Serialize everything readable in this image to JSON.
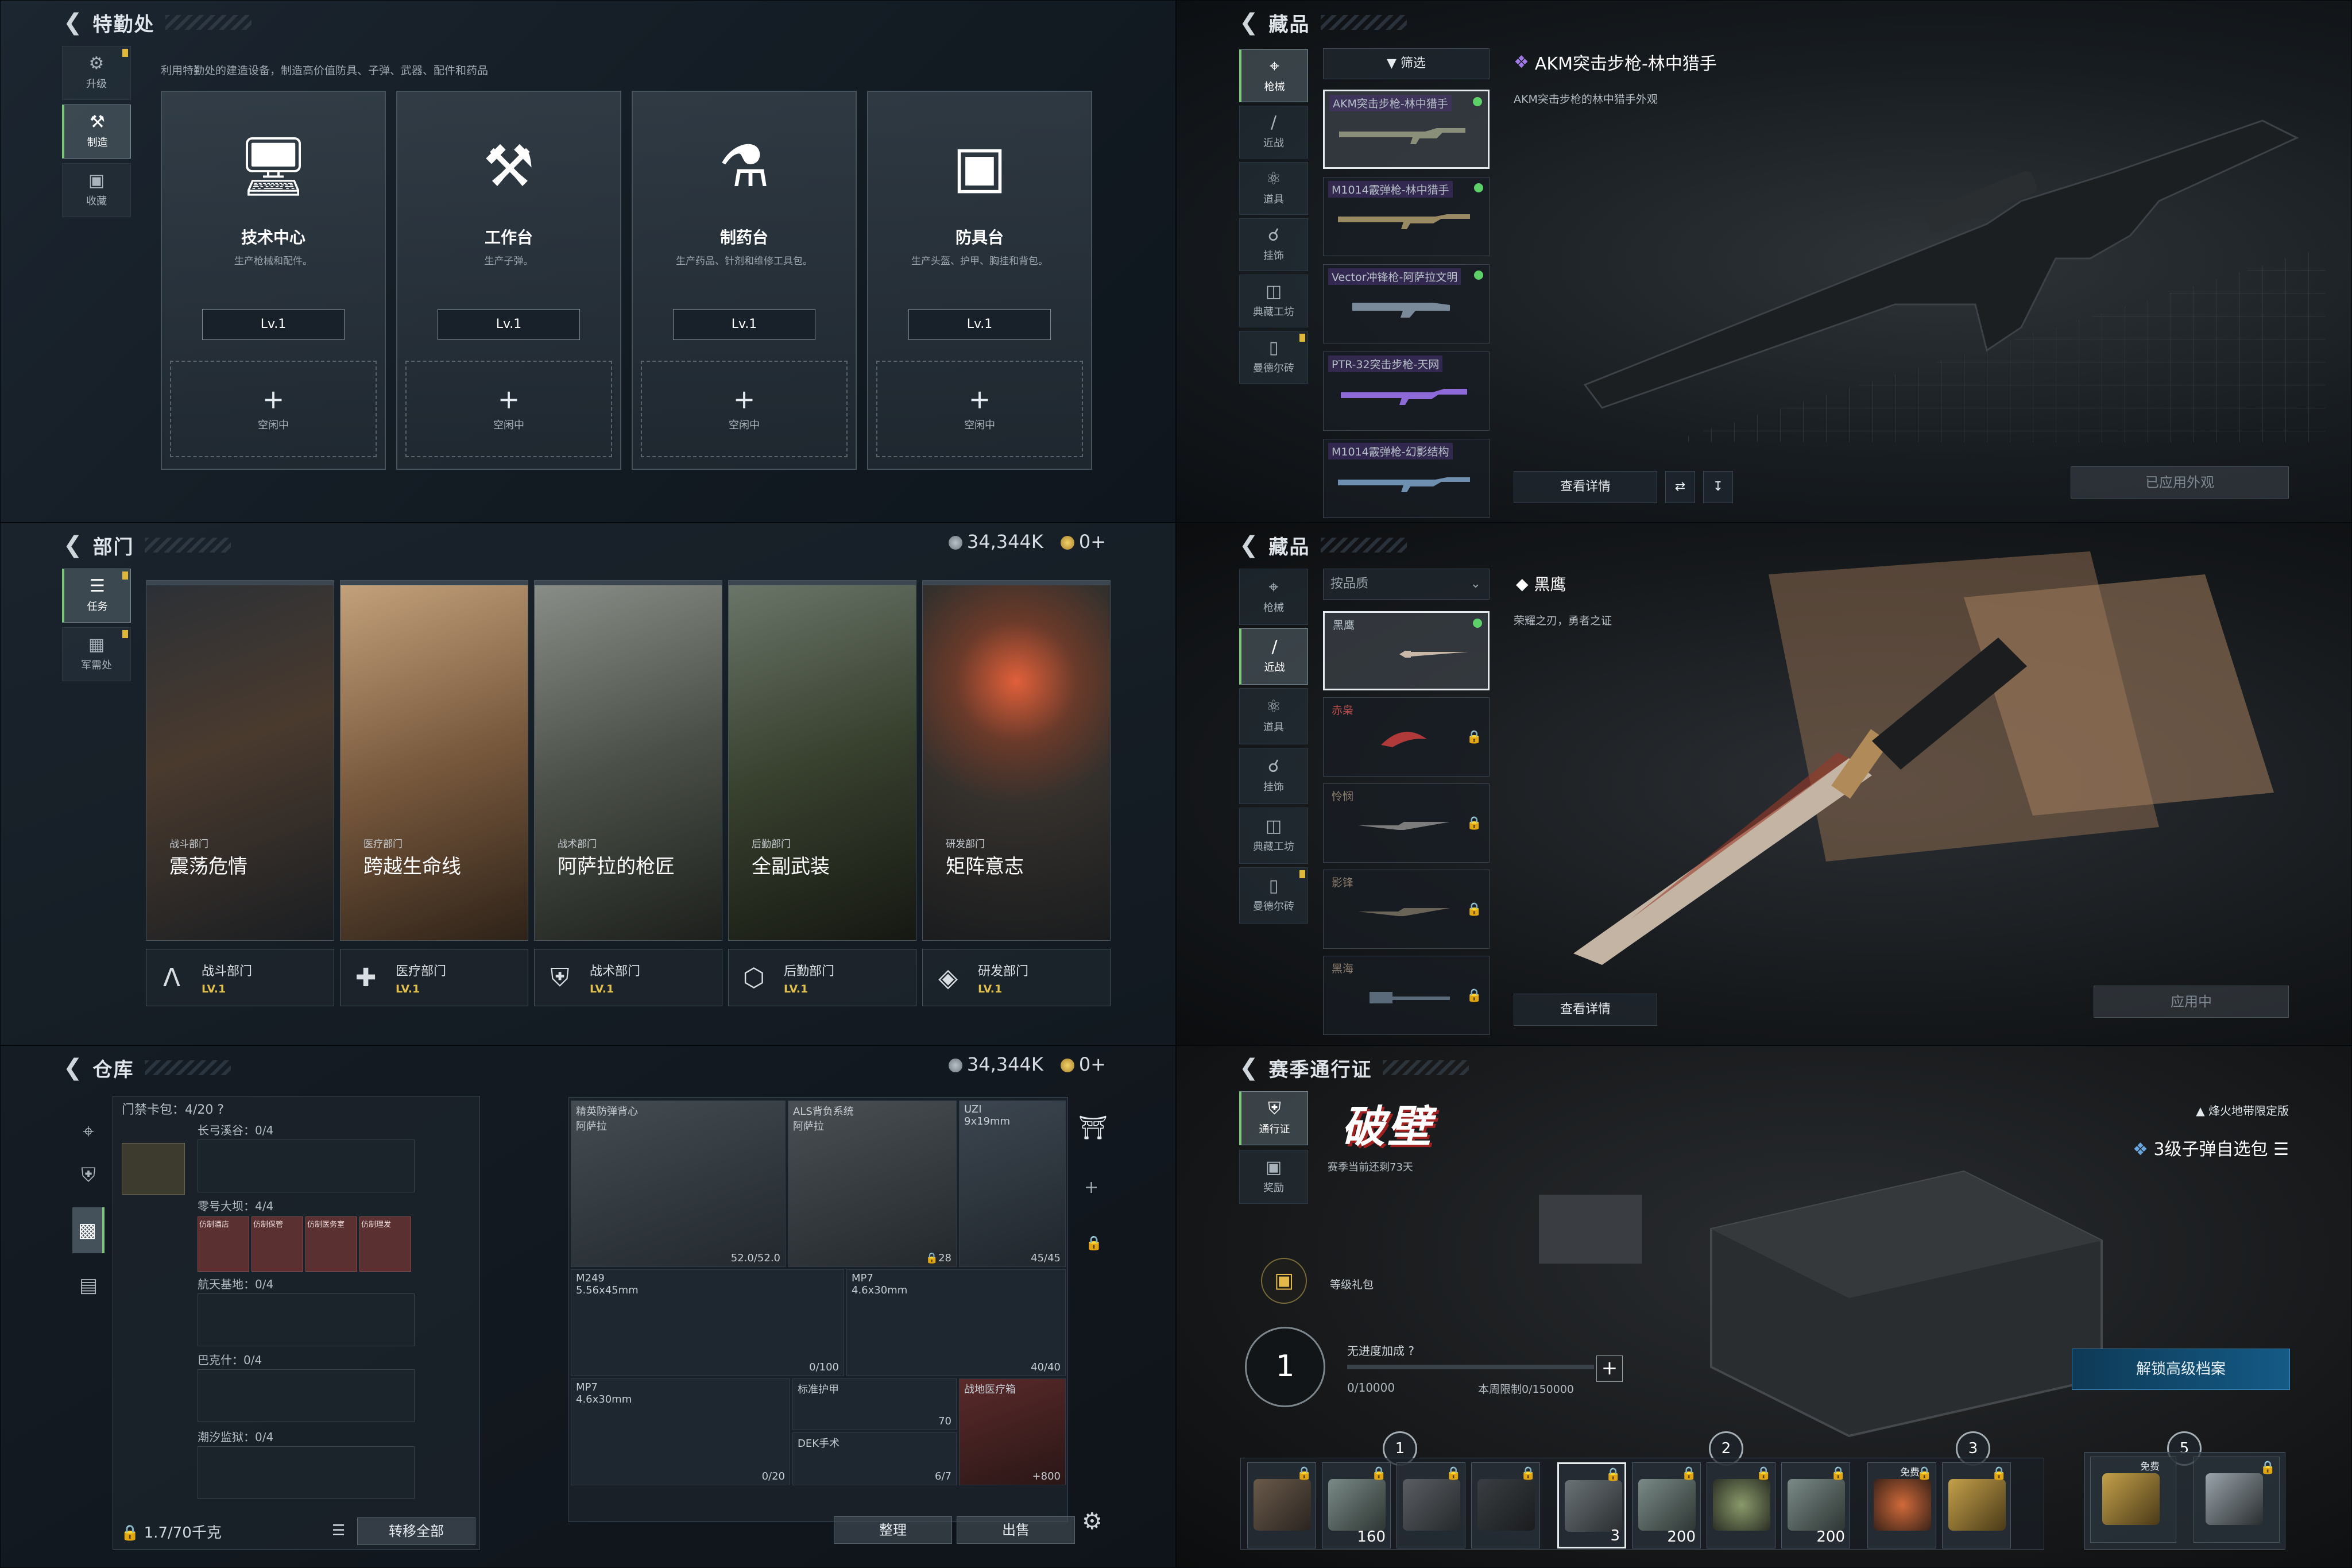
{
  "panel1": {
    "title": "特勤处",
    "subtitle": "利用特勤处的建造设备，制造高价值防具、子弹、武器、配件和药品",
    "nav": [
      {
        "label": "升级",
        "icon": "upgrade-icon"
      },
      {
        "label": "制造",
        "icon": "craft-icon"
      },
      {
        "label": "收藏",
        "icon": "collection-icon"
      }
    ],
    "stations": [
      {
        "name": "技术中心",
        "desc": "生产枪械和配件。",
        "level": "Lv.1",
        "slot": "空闲中"
      },
      {
        "name": "工作台",
        "desc": "生产子弹。",
        "level": "Lv.1",
        "slot": "空闲中"
      },
      {
        "name": "制药台",
        "desc": "生产药品、针剂和维修工具包。",
        "level": "Lv.1",
        "slot": "空闲中"
      },
      {
        "name": "防具台",
        "desc": "生产头盔、护甲、胸挂和背包。",
        "level": "Lv.1",
        "slot": "空闲中"
      }
    ]
  },
  "panel2": {
    "title": "藏品",
    "filter": "筛选",
    "nav": [
      {
        "label": "枪械"
      },
      {
        "label": "近战"
      },
      {
        "label": "道具"
      },
      {
        "label": "挂饰"
      },
      {
        "label": "典藏工坊"
      },
      {
        "label": "曼德尔砖"
      }
    ],
    "items": [
      {
        "name": "AKM突击步枪-林中猎手"
      },
      {
        "name": "M1014霰弹枪-林中猎手"
      },
      {
        "name": "Vector冲锋枪-阿萨拉文明"
      },
      {
        "name": "PTR-32突击步枪-天网"
      },
      {
        "name": "M1014霰弹枪-幻影结构"
      }
    ],
    "selected_title": "AKM突击步枪-林中猎手",
    "selected_desc": "AKM突击步枪的林中猎手外观",
    "detail_btn": "查看详情",
    "applied": "已应用外观"
  },
  "panel3": {
    "title": "部门",
    "currency1": "34,344K",
    "currency2": "0+",
    "nav": [
      {
        "label": "任务"
      },
      {
        "label": "军需处"
      }
    ],
    "depts": [
      {
        "small": "战斗部门",
        "name": "震荡危情",
        "card": "战斗部门",
        "lv": "LV.1"
      },
      {
        "small": "医疗部门",
        "name": "跨越生命线",
        "card": "医疗部门",
        "lv": "LV.1"
      },
      {
        "small": "战术部门",
        "name": "阿萨拉的枪匠",
        "card": "战术部门",
        "lv": "LV.1"
      },
      {
        "small": "后勤部门",
        "name": "全副武装",
        "card": "后勤部门",
        "lv": "LV.1"
      },
      {
        "small": "研发部门",
        "name": "矩阵意志",
        "card": "研发部门",
        "lv": "LV.1"
      }
    ]
  },
  "panel4": {
    "title": "藏品",
    "sort": "按品质",
    "nav": [
      {
        "label": "枪械"
      },
      {
        "label": "近战"
      },
      {
        "label": "道具"
      },
      {
        "label": "挂饰"
      },
      {
        "label": "典藏工坊"
      },
      {
        "label": "曼德尔砖"
      }
    ],
    "items": [
      {
        "name": "黑鹰"
      },
      {
        "name": "赤枭"
      },
      {
        "name": "怜悯"
      },
      {
        "name": "影锋"
      },
      {
        "name": "黑海"
      }
    ],
    "selected_title": "黑鹰",
    "selected_desc": "荣耀之刃，勇者之证",
    "detail_btn": "查看详情",
    "applied": "应用中"
  },
  "panel5": {
    "title": "仓库",
    "currency1": "34,344K",
    "currency2": "0+",
    "keycard": "门禁卡包：4/20",
    "help": "?",
    "groups": [
      {
        "label": "长弓溪谷：0/4"
      },
      {
        "label": "零号大坝：4/4"
      },
      {
        "label": "航天基地：0/4"
      },
      {
        "label": "巴克什：0/4"
      },
      {
        "label": "潮汐监狱：0/4"
      }
    ],
    "keys": [
      "仿制酒店",
      "仿制保管",
      "仿制医务室",
      "仿制理发"
    ],
    "cells": [
      {
        "name": "精英防弹背心",
        "sub": "阿萨拉",
        "val": "52.0/52.0"
      },
      {
        "name": "ALS背负系统",
        "sub": "阿萨拉",
        "val": "28"
      },
      {
        "name": "UZI",
        "sub": "9x19mm",
        "val": "45/45"
      },
      {
        "name": "M249",
        "sub": "5.56x45mm",
        "val": "0/100"
      },
      {
        "name": "MP7",
        "sub": "4.6x30mm",
        "val": "40/40"
      },
      {
        "name": "MP7",
        "sub": "4.6x30mm",
        "val": "0/20"
      },
      {
        "name": "标准护甲",
        "sub": "",
        "val": "70"
      },
      {
        "name": "DEK手术",
        "sub": "",
        "val": "6/7"
      },
      {
        "name": "战地医疗箱",
        "sub": "",
        "val": "800"
      }
    ],
    "weight": "1.7/70千克",
    "transfer_all": "转移全部",
    "sort_btn": "整理",
    "sell_btn": "出售"
  },
  "panel6": {
    "title": "赛季通行证",
    "season_logo": "破壁",
    "season_days": "赛季当前还剩73天",
    "nav": [
      {
        "label": "通行证"
      },
      {
        "label": "奖励"
      }
    ],
    "tag": "烽火地带限定版",
    "reward_title": "3级子弹自选包",
    "gift": "等级礼包",
    "level": "1",
    "progress_label": "无进度加成",
    "progress": "0/10000",
    "weekly": "本周限制0/150000",
    "unlock": "解锁高级档案",
    "tiers": [
      "1",
      "2",
      "3",
      "5"
    ],
    "counts": [
      "160",
      "3",
      "200",
      "200"
    ],
    "free": "免费"
  }
}
